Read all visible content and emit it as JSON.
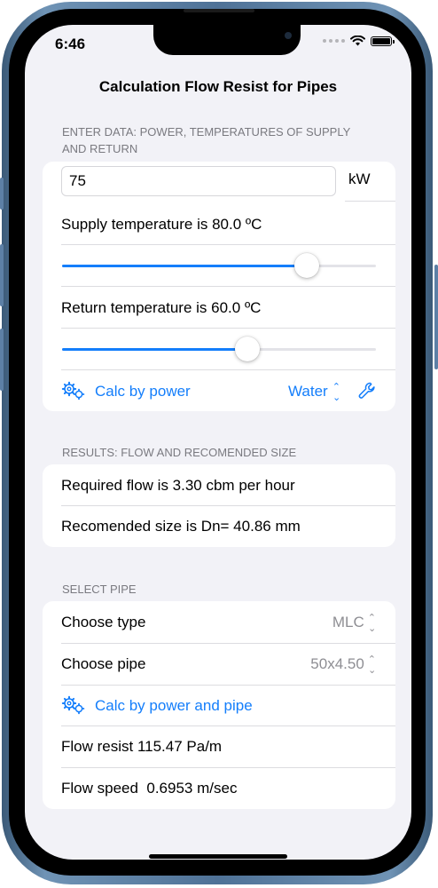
{
  "status": {
    "time": "6:46"
  },
  "nav": {
    "title": "Calculation Flow Resist for Pipes"
  },
  "input_section": {
    "header_line1": "ENTER DATA: POWER, TEMPERATURES OF SUPPLY",
    "header_line2": "AND RETURN",
    "power_value": "75",
    "power_unit": "kW",
    "supply_label": "Supply temperature is 80.0 ºC",
    "supply_level": 0.78,
    "return_label": "Return temperature is 60.0 ºC",
    "return_level": 0.59,
    "calc_by_power": "Calc by power",
    "fluid": "Water"
  },
  "results_section": {
    "header": "RESULTS: FLOW AND RECOMENDED SIZE",
    "required_flow": "Required flow is 3.30 cbm per hour",
    "recommended_size": "Recomended size is Dn= 40.86 mm"
  },
  "pipe_section": {
    "header": "SELECT PIPE",
    "choose_type_label": "Choose type",
    "choose_type_value": "MLC",
    "choose_pipe_label": "Choose pipe",
    "choose_pipe_value": "50x4.50",
    "calc_by_power_and_pipe": "Calc by power and pipe",
    "flow_resist": "Flow resist 115.47 Pa/m",
    "flow_speed": "Flow speed  0.6953 m/sec"
  },
  "colors": {
    "accent": "#147efb",
    "background": "#f2f2f7",
    "frame": "#4f7297"
  }
}
